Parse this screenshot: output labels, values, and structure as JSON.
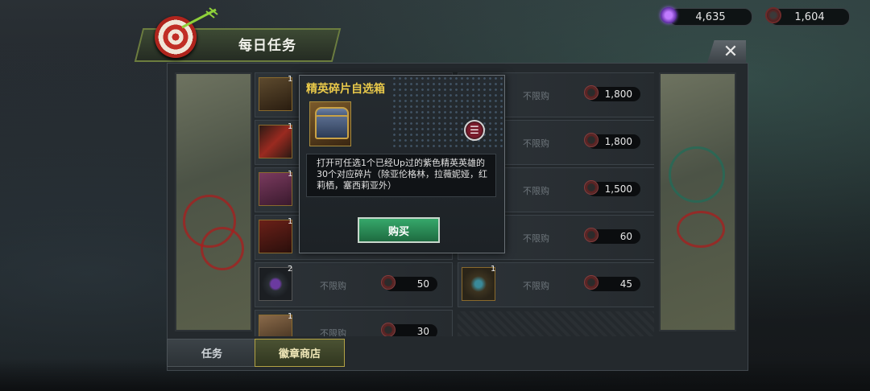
{
  "currency": {
    "gems": "4,635",
    "coins": "1,604",
    "gem_icon": "purple-gem-icon",
    "coin_icon": "red-medal-icon"
  },
  "header": {
    "title": "每日任务",
    "close_label": "✕"
  },
  "popup": {
    "title": "精英碎片自选箱",
    "description": "打开可任选1个已经Up过的紫色精英英雄的30个对应碎片（除亚伦格林，拉薇妮娅，红莉栖，塞西莉亚外）",
    "buy_label": "购买",
    "info_icon": "menu-list-icon"
  },
  "shop": {
    "left_column": [
      {
        "qty": "1",
        "limit": "",
        "price": "",
        "icon": "chest-icon"
      },
      {
        "qty": "1",
        "limit": "",
        "price": "",
        "icon": "red-spear-icon"
      },
      {
        "qty": "1",
        "limit": "",
        "price": "",
        "icon": "gem-box-icon"
      },
      {
        "qty": "1",
        "limit": "",
        "price": "",
        "icon": "hammer-icon"
      },
      {
        "qty": "2",
        "limit": "不限购",
        "price": "50",
        "icon": "purple-chip-icon"
      },
      {
        "qty": "1",
        "limit": "不限购",
        "price": "30",
        "icon": "scroll-icon"
      }
    ],
    "right_column": [
      {
        "qty": "",
        "limit": "不限购",
        "price": "1,800",
        "icon": ""
      },
      {
        "qty": "",
        "limit": "不限购",
        "price": "1,800",
        "icon": ""
      },
      {
        "qty": "",
        "limit": "不限购",
        "price": "1,500",
        "icon": ""
      },
      {
        "qty": "",
        "limit": "不限购",
        "price": "60",
        "icon": ""
      },
      {
        "qty": "1",
        "limit": "不限购",
        "price": "45",
        "icon": "blue-shuriken-icon"
      }
    ]
  },
  "tabs": {
    "task": "任务",
    "badge_shop": "徽章商店"
  }
}
